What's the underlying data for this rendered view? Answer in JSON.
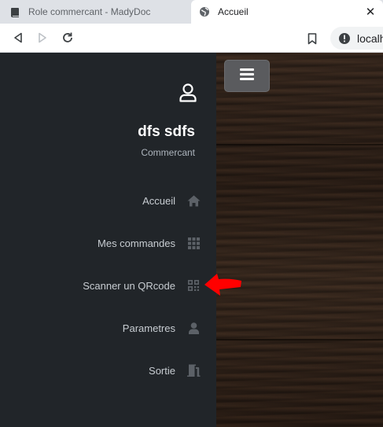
{
  "browser": {
    "tabs": [
      {
        "title": "Role commercant - MadyDoc",
        "icon": "book-icon",
        "active": false
      },
      {
        "title": "Accueil",
        "icon": "globe-icon",
        "active": true
      }
    ],
    "url": "localh",
    "colors": {
      "tabstrip": "#dee1e6",
      "active_tab": "#ffffff"
    }
  },
  "sidebar": {
    "user": {
      "name": "dfs sdfs",
      "role": "Commercant",
      "icon": "user-icon"
    },
    "items": [
      {
        "label": "Accueil",
        "icon": "home-icon"
      },
      {
        "label": "Mes commandes",
        "icon": "grid-icon"
      },
      {
        "label": "Scanner un QRcode",
        "icon": "qrcode-icon"
      },
      {
        "label": "Parametres",
        "icon": "person-icon"
      },
      {
        "label": "Sortie",
        "icon": "door-exit-icon"
      }
    ],
    "colors": {
      "background": "#212529",
      "icon": "#5c6167",
      "label": "#c8cdd2"
    }
  },
  "main": {
    "menu_icon": "hamburger-icon",
    "background": "dark-wood",
    "colors": {
      "button": "#5a5b5e"
    }
  },
  "annotation": {
    "shape": "red-arrow",
    "color": "#ff0000"
  }
}
